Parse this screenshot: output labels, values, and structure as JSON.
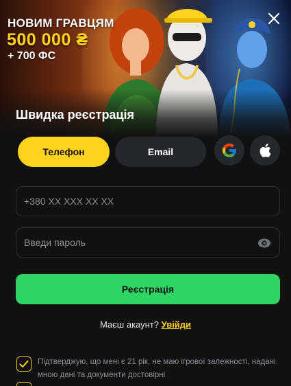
{
  "banner": {
    "line1": "НОВИМ ГРАВЦЯМ",
    "amount": "500 000 ₴",
    "bonus": "+ 700 ФС"
  },
  "title": "Швидка реєстрація",
  "tabs": [
    {
      "label": "Телефон",
      "active": true
    },
    {
      "label": "Email",
      "active": false
    }
  ],
  "social": [
    "google-icon",
    "apple-icon"
  ],
  "fields": {
    "phone_placeholder": "+380 XX XXX XX XX",
    "password_placeholder": "Введи пароль"
  },
  "submit_label": "Реєстрація",
  "login": {
    "prompt": "Маєш акаунт?",
    "link": "Увійди"
  },
  "consent": {
    "checked": true,
    "text": "Підтверджую, що мені є 21 рік, не маю ігрової залежності, надані мною дані та документи достовірні"
  },
  "colors": {
    "accent": "#ffd21e",
    "success": "#2ed564",
    "background": "#111111",
    "surface": "#24272c"
  }
}
